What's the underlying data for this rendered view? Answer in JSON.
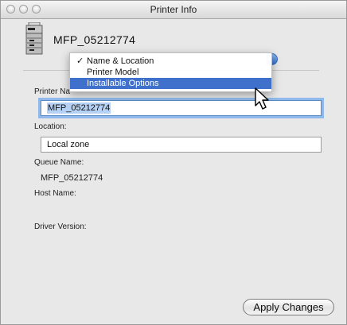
{
  "window": {
    "title": "Printer Info"
  },
  "device": {
    "name": "MFP_05212774"
  },
  "menu": {
    "items": [
      {
        "label": "Name & Location",
        "checked": true,
        "check_glyph": "✓"
      },
      {
        "label": "Printer Model",
        "checked": false
      },
      {
        "label": "Installable Options",
        "checked": false,
        "highlighted": true
      }
    ]
  },
  "fields": {
    "printer_name_label_visible": "Printer Na",
    "printer_name_value": "MFP_05212774",
    "location_label": "Location:",
    "location_value": "Local zone",
    "queue_name_label": "Queue Name:",
    "queue_name_value": "MFP_05212774",
    "host_name_label": "Host Name:",
    "driver_version_label": "Driver Version:"
  },
  "actions": {
    "apply_label": "Apply Changes"
  },
  "icons": {
    "printer": "printer-icon",
    "cursor": "arrow-cursor-icon"
  },
  "colors": {
    "menu_highlight": "#3e70cc",
    "focus_ring": "#8fb9ea",
    "selection": "#b5d1f5"
  }
}
